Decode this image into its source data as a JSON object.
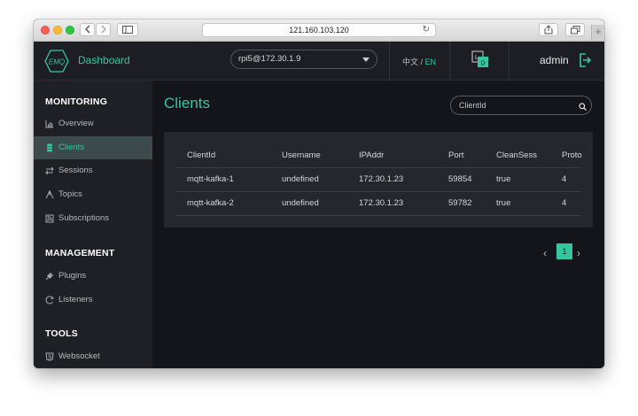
{
  "browser": {
    "url": "121.160.103.120",
    "plus_label": "+"
  },
  "header": {
    "brand": "Dashboard",
    "logo_text": "EMQ",
    "node": "rpi5@172.30.1.9",
    "lang_cn": "中文",
    "lang_sep": " / ",
    "lang_en": "EN",
    "user": "admin"
  },
  "sidebar": {
    "sections": [
      {
        "title": "MONITORING",
        "items": [
          {
            "label": "Overview",
            "icon": "bar-chart-icon",
            "active": false
          },
          {
            "label": "Clients",
            "icon": "clients-icon",
            "active": true
          },
          {
            "label": "Sessions",
            "icon": "sessions-icon",
            "active": false
          },
          {
            "label": "Topics",
            "icon": "topics-icon",
            "active": false
          },
          {
            "label": "Subscriptions",
            "icon": "subscriptions-icon",
            "active": false
          }
        ]
      },
      {
        "title": "MANAGEMENT",
        "items": [
          {
            "label": "Plugins",
            "icon": "plug-icon",
            "active": false
          },
          {
            "label": "Listeners",
            "icon": "listeners-icon",
            "active": false
          }
        ]
      },
      {
        "title": "TOOLS",
        "items": [
          {
            "label": "Websocket",
            "icon": "html5-icon",
            "active": false
          }
        ]
      }
    ]
  },
  "main": {
    "title": "Clients",
    "search_placeholder": "ClientId",
    "table": {
      "columns": [
        "ClientId",
        "Username",
        "IPAddr",
        "Port",
        "CleanSess",
        "Proto"
      ],
      "rows": [
        [
          "mqtt-kafka-1",
          "undefined",
          "172.30.1.23",
          "59854",
          "true",
          "4"
        ],
        [
          "mqtt-kafka-2",
          "undefined",
          "172.30.1.23",
          "59782",
          "true",
          "4"
        ]
      ]
    },
    "pagination": {
      "current": "1",
      "prev": "‹",
      "next": "›"
    }
  },
  "colors": {
    "accent": "#33c79f",
    "sidebar_bg": "#1e2026",
    "main_bg": "#14151a",
    "card_bg": "#25272d",
    "active_bg": "#3d4a4c"
  }
}
